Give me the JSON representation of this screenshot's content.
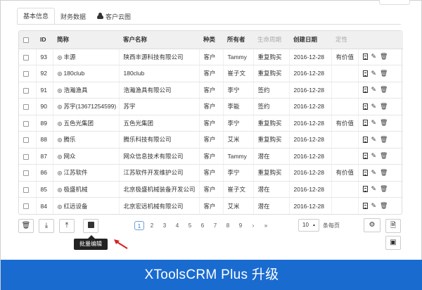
{
  "top_button": {
    "label": "····"
  },
  "tabs": [
    {
      "label": "基本信息",
      "active": true
    },
    {
      "label": "财务数据",
      "active": false
    },
    {
      "label": "客户云图",
      "active": false,
      "icon": "cloud-icon"
    }
  ],
  "table": {
    "headers": {
      "id": "ID",
      "short": "简称",
      "company": "客户名称",
      "type": "种类",
      "owner": "所有者",
      "lifecycle": "生命周期",
      "created": "创建日期",
      "status": "定性"
    },
    "rows": [
      {
        "id": "93",
        "short": "丰源",
        "company": "陕西丰源科技有限公司",
        "type": "客户",
        "owner": "Tammy",
        "lifecycle": "重复购买",
        "created": "2016-12-28",
        "status": "有价值"
      },
      {
        "id": "92",
        "short": "180club",
        "company": "180club",
        "type": "客户",
        "owner": "崔子文",
        "lifecycle": "重复购买",
        "created": "2016-12-28",
        "status": ""
      },
      {
        "id": "91",
        "short": "浩瀚渔具",
        "company": "浩瀚渔具有限公司",
        "type": "客户",
        "owner": "李宁",
        "lifecycle": "签约",
        "created": "2016-12-28",
        "status": ""
      },
      {
        "id": "90",
        "short": "苏宇(13671254599)",
        "company": "苏宇",
        "type": "客户",
        "owner": "李能",
        "lifecycle": "签约",
        "created": "2016-12-28",
        "status": ""
      },
      {
        "id": "89",
        "short": "五色光集团",
        "company": "五色光集团",
        "type": "客户",
        "owner": "李宁",
        "lifecycle": "重复购买",
        "created": "2016-12-28",
        "status": "有价值"
      },
      {
        "id": "88",
        "short": "腾乐",
        "company": "腾乐科技有限公司",
        "type": "客户",
        "owner": "艾米",
        "lifecycle": "重复购买",
        "created": "2016-12-28",
        "status": ""
      },
      {
        "id": "87",
        "short": "网众",
        "company": "网众信息技术有限公司",
        "type": "客户",
        "owner": "Tammy",
        "lifecycle": "潜在",
        "created": "2016-12-28",
        "status": ""
      },
      {
        "id": "86",
        "short": "江苏软件",
        "company": "江苏软件开发维护公司",
        "type": "客户",
        "owner": "李宁",
        "lifecycle": "重复购买",
        "created": "2016-12-28",
        "status": "有价值"
      },
      {
        "id": "85",
        "short": "极盛机械",
        "company": "北京极盛机械装备开发公司",
        "type": "客户",
        "owner": "崔子文",
        "lifecycle": "潜在",
        "created": "2016-12-28",
        "status": ""
      },
      {
        "id": "84",
        "short": "红远设备",
        "company": "北京宏远机械有限公司",
        "type": "客户",
        "owner": "艾米",
        "lifecycle": "潜在",
        "created": "2016-12-28",
        "status": ""
      }
    ]
  },
  "pagination": {
    "pages": [
      "1",
      "2",
      "3",
      "4",
      "5",
      "6",
      "7",
      "8",
      "9",
      "›",
      "»"
    ],
    "current": "1",
    "page_size": "10",
    "per_page_label": "条每页"
  },
  "tooltip": "批量编辑",
  "banner": "XToolsCRM Plus  升级",
  "colors": {
    "banner": "#1a6bd0",
    "tooltip": "#222222",
    "pager_active": "#3a7bc8"
  }
}
